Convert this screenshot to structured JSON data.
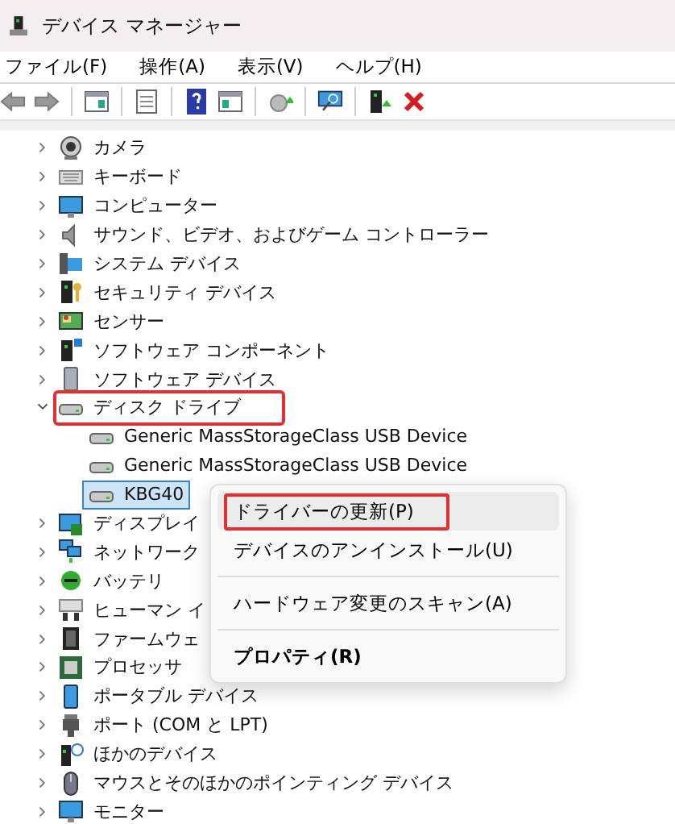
{
  "window": {
    "title": "デバイス マネージャー"
  },
  "menu": [
    {
      "label": "ファイル(F)"
    },
    {
      "label": "操作(A)"
    },
    {
      "label": "表示(V)"
    },
    {
      "label": "ヘルプ(H)"
    }
  ],
  "tree": [
    {
      "label": "カメラ",
      "expanded": false,
      "annotated": false
    },
    {
      "label": "キーボード",
      "expanded": false,
      "annotated": false
    },
    {
      "label": "コンピューター",
      "expanded": false,
      "annotated": false
    },
    {
      "label": "サウンド、ビデオ、およびゲーム コントローラー",
      "expanded": false,
      "annotated": false
    },
    {
      "label": "システム デバイス",
      "expanded": false,
      "annotated": false
    },
    {
      "label": "セキュリティ デバイス",
      "expanded": false,
      "annotated": false
    },
    {
      "label": "センサー",
      "expanded": false,
      "annotated": false
    },
    {
      "label": "ソフトウェア コンポーネント",
      "expanded": false,
      "annotated": false
    },
    {
      "label": "ソフトウェア デバイス",
      "expanded": false,
      "annotated": false
    },
    {
      "label": "ディスク ドライブ",
      "expanded": true,
      "annotated": true,
      "children": [
        {
          "label": "Generic MassStorageClass USB Device",
          "selected": false
        },
        {
          "label": "Generic MassStorageClass USB Device",
          "selected": false
        },
        {
          "label": "KBG40",
          "selected": true
        }
      ]
    },
    {
      "label": "ディスプレイ",
      "expanded": false,
      "annotated": false
    },
    {
      "label": "ネットワーク",
      "expanded": false,
      "annotated": false
    },
    {
      "label": "バッテリ",
      "expanded": false,
      "annotated": false
    },
    {
      "label": "ヒューマン イ",
      "expanded": false,
      "annotated": false
    },
    {
      "label": "ファームウェ",
      "expanded": false,
      "annotated": false
    },
    {
      "label": "プロセッサ",
      "expanded": false,
      "annotated": false
    },
    {
      "label": "ポータブル デバイス",
      "expanded": false,
      "annotated": false
    },
    {
      "label": "ポート (COM と LPT)",
      "expanded": false,
      "annotated": false
    },
    {
      "label": "ほかのデバイス",
      "expanded": false,
      "annotated": false
    },
    {
      "label": "マウスとそのほかのポインティング デバイス",
      "expanded": false,
      "annotated": false
    },
    {
      "label": "モニター",
      "expanded": false,
      "annotated": false
    }
  ],
  "context_menu": {
    "items": [
      {
        "kind": "item",
        "label": "ドライバーの更新(P)",
        "hovered": true,
        "annotated": true,
        "default": false
      },
      {
        "kind": "item",
        "label": "デバイスのアンインストール(U)",
        "hovered": false,
        "annotated": false,
        "default": false
      },
      {
        "kind": "separator"
      },
      {
        "kind": "item",
        "label": "ハードウェア変更のスキャン(A)",
        "hovered": false,
        "annotated": false,
        "default": false
      },
      {
        "kind": "separator"
      },
      {
        "kind": "item",
        "label": "プロパティ(R)",
        "hovered": false,
        "annotated": false,
        "default": true
      }
    ]
  }
}
